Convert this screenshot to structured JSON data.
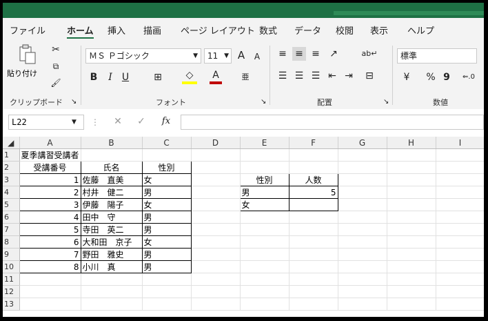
{
  "ribbon_tabs": [
    "ファイル",
    "ホーム",
    "挿入",
    "描画",
    "ページ レイアウト",
    "数式",
    "データ",
    "校閲",
    "表示",
    "ヘルプ"
  ],
  "active_tab": "ホーム",
  "ribbon": {
    "paste_label": "貼り付け",
    "clipboard_group": "クリップボード",
    "font_name": "ＭＳ Ｐゴシック",
    "font_size": "11",
    "grow_font": "A",
    "shrink_font": "A",
    "bold": "B",
    "italic": "I",
    "underline": "U",
    "font_color_glyph": "A",
    "font_group": "フォント",
    "alignment_group": "配置",
    "number_format": "標準",
    "percent": "%",
    "comma": "9",
    "number_group": "数値",
    "accent_color": "#1e7145",
    "font_color": "#c00000",
    "fill_color": "#ffff00"
  },
  "formula_bar": {
    "name_box": "L22",
    "fx": "fx",
    "formula": ""
  },
  "sheet": {
    "columns": [
      "A",
      "B",
      "C",
      "D",
      "E",
      "F",
      "G",
      "H",
      "I"
    ],
    "rows": [
      {
        "n": "1",
        "a": "夏季講習受講者",
        "b": "",
        "c": "",
        "e": "",
        "f": ""
      },
      {
        "n": "2",
        "a": "受講番号",
        "b": "氏名",
        "c": "性別",
        "e": "",
        "f": ""
      },
      {
        "n": "3",
        "a": "1",
        "b": "佐藤　直美",
        "c": "女",
        "e": "性別",
        "f": "人数"
      },
      {
        "n": "4",
        "a": "2",
        "b": "村井　健二",
        "c": "男",
        "e": "男",
        "f": "5"
      },
      {
        "n": "5",
        "a": "3",
        "b": "伊藤　陽子",
        "c": "女",
        "e": "女",
        "f": ""
      },
      {
        "n": "6",
        "a": "4",
        "b": "田中　守",
        "c": "男",
        "e": "",
        "f": ""
      },
      {
        "n": "7",
        "a": "5",
        "b": "寺田　英二",
        "c": "男",
        "e": "",
        "f": ""
      },
      {
        "n": "8",
        "a": "6",
        "b": "大和田　京子",
        "c": "女",
        "e": "",
        "f": ""
      },
      {
        "n": "9",
        "a": "7",
        "b": "野田　雅史",
        "c": "男",
        "e": "",
        "f": ""
      },
      {
        "n": "10",
        "a": "8",
        "b": "小川　真",
        "c": "男",
        "e": "",
        "f": ""
      },
      {
        "n": "11",
        "a": "",
        "b": "",
        "c": "",
        "e": "",
        "f": ""
      },
      {
        "n": "12",
        "a": "",
        "b": "",
        "c": "",
        "e": "",
        "f": ""
      },
      {
        "n": "13",
        "a": "",
        "b": "",
        "c": "",
        "e": "",
        "f": ""
      }
    ]
  }
}
